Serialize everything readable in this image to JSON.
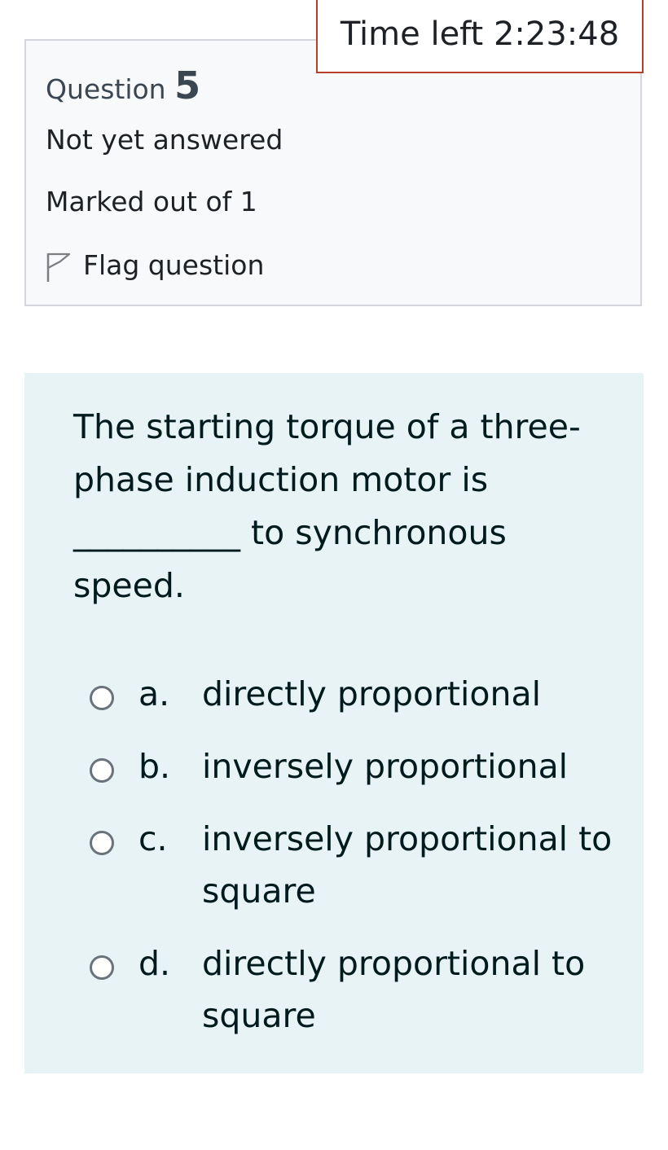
{
  "info": {
    "question_label": "Question",
    "question_number": "5",
    "state": "Not yet answered",
    "grade": "Marked out of 1",
    "flag_label": "Flag question",
    "flag_icon": "flag-outline-icon"
  },
  "timer": {
    "text": "Time left 2:23:48"
  },
  "question": {
    "text_part1": "The starting torque of a three-phase induction motor is",
    "blank": "__________",
    "text_part2": "to synchronous speed."
  },
  "answers": [
    {
      "letter": "a.",
      "text": "directly proportional"
    },
    {
      "letter": "b.",
      "text": "inversely proportional"
    },
    {
      "letter": "c.",
      "text": "inversely proportional to square"
    },
    {
      "letter": "d.",
      "text": "directly proportional to square"
    }
  ],
  "colors": {
    "info_bg": "#f8f9fa",
    "content_bg": "#e7f3f5",
    "timer_border": "#b8402a"
  }
}
